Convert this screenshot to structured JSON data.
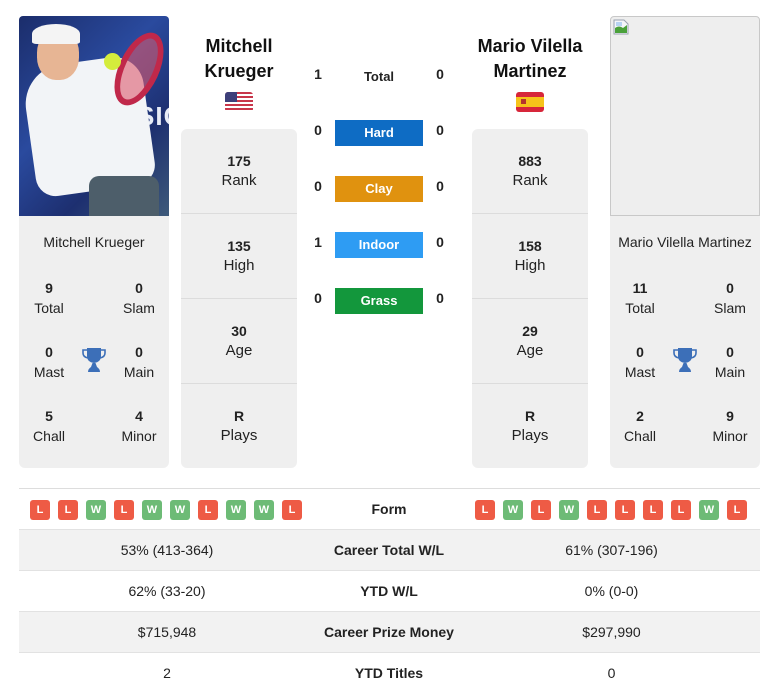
{
  "players": {
    "left": {
      "name_line1": "Mitchell",
      "name_line2": "Krueger",
      "full_name": "Mitchell Krueger",
      "country_flag": "usa-flag",
      "photo_bg_text": "SIC",
      "rank": "175",
      "rank_label": "Rank",
      "high": "135",
      "high_label": "High",
      "age": "30",
      "age_label": "Age",
      "plays": "R",
      "plays_label": "Plays",
      "titles": {
        "total": "9",
        "total_label": "Total",
        "slam": "0",
        "slam_label": "Slam",
        "mast": "0",
        "mast_label": "Mast",
        "main": "0",
        "main_label": "Main",
        "chall": "5",
        "chall_label": "Chall",
        "minor": "4",
        "minor_label": "Minor"
      }
    },
    "right": {
      "name_line1": "Mario Vilella",
      "name_line2": "Martinez",
      "full_name": "Mario Vilella Martinez",
      "country_flag": "spain-flag",
      "rank": "883",
      "rank_label": "Rank",
      "high": "158",
      "high_label": "High",
      "age": "29",
      "age_label": "Age",
      "plays": "R",
      "plays_label": "Plays",
      "titles": {
        "total": "11",
        "total_label": "Total",
        "slam": "0",
        "slam_label": "Slam",
        "mast": "0",
        "mast_label": "Mast",
        "main": "0",
        "main_label": "Main",
        "chall": "2",
        "chall_label": "Chall",
        "minor": "9",
        "minor_label": "Minor"
      }
    }
  },
  "h2h": {
    "total": {
      "label": "Total",
      "left": "1",
      "right": "0"
    },
    "surfaces": [
      {
        "label": "Hard",
        "left": "0",
        "right": "0",
        "color": "#0e6cc4"
      },
      {
        "label": "Clay",
        "left": "0",
        "right": "0",
        "color": "#e0920f"
      },
      {
        "label": "Indoor",
        "left": "1",
        "right": "0",
        "color": "#2e9cf3"
      },
      {
        "label": "Grass",
        "left": "0",
        "right": "0",
        "color": "#13973c"
      }
    ]
  },
  "form": {
    "label": "Form",
    "left": [
      "L",
      "L",
      "W",
      "L",
      "W",
      "W",
      "L",
      "W",
      "W",
      "L"
    ],
    "right": [
      "L",
      "W",
      "L",
      "W",
      "L",
      "L",
      "L",
      "L",
      "W",
      "L"
    ]
  },
  "stats": [
    {
      "label": "Career Total W/L",
      "left": "53% (413-364)",
      "right": "61% (307-196)"
    },
    {
      "label": "YTD W/L",
      "left": "62% (33-20)",
      "right": "0% (0-0)"
    },
    {
      "label": "Career Prize Money",
      "left": "$715,948",
      "right": "$297,990"
    },
    {
      "label": "YTD Titles",
      "left": "2",
      "right": "0"
    }
  ],
  "colors": {
    "loss": "#ee5b45",
    "win": "#6dbb76",
    "trophy": "#3c6fb8",
    "card_bg": "#efefef"
  }
}
